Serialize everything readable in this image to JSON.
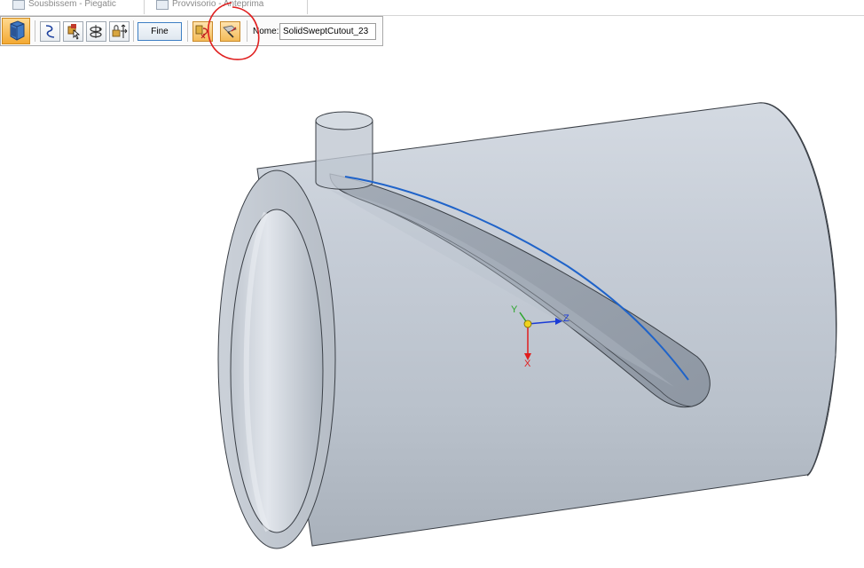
{
  "tabs": [
    {
      "label": "Sousbissem - Piegatic"
    },
    {
      "label": "Provvisorio - Anteprima"
    }
  ],
  "commandbar": {
    "fine_label": "Fine",
    "name_label": "Nome:",
    "name_value": "SolidSweptCutout_23"
  },
  "icons": {
    "home": "sweep-step-icon",
    "path": "path-curve-icon",
    "cross_section": "cross-section-icon",
    "orientation": "orientation-icon",
    "lock": "lock-move-icon",
    "treatment1": "treatment-active-icon",
    "treatment2": "treatment-follow-icon"
  },
  "annotation": {
    "type": "red freehand circle around treatment buttons",
    "color": "#e02020"
  },
  "triad": {
    "x_label": "X",
    "y_label": "Y",
    "z_label": "Z",
    "x_color": "#e11d1d",
    "y_color": "#2aa52a",
    "z_color": "#1a3bd6"
  },
  "model": {
    "description_color_body": "#c2cad4",
    "path_color": "#1f63c9"
  }
}
